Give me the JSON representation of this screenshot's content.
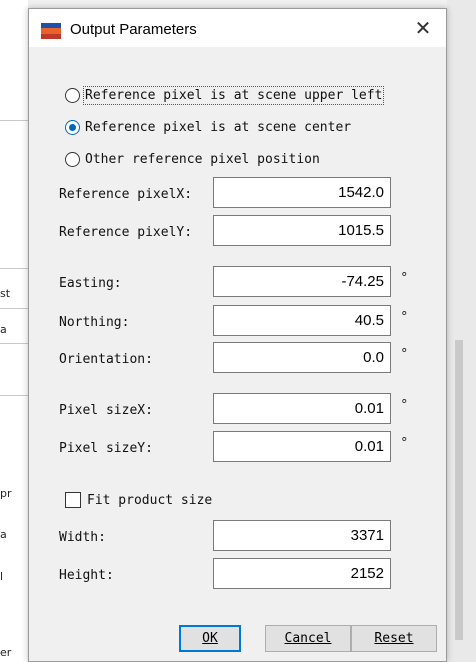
{
  "dialog": {
    "title": "Output Parameters",
    "close_symbol": "✕"
  },
  "background_fragments": [
    "st",
    "a",
    "pr",
    "a",
    "l",
    "er"
  ],
  "reference_options": [
    {
      "label": "Reference pixel is at scene upper left",
      "checked": false
    },
    {
      "label": "Reference pixel is at scene center",
      "checked": true
    },
    {
      "label": "Other reference pixel position",
      "checked": false
    }
  ],
  "fields": {
    "ref_pixel_x": {
      "label": "Reference pixelX:",
      "value": "1542.0",
      "unit": ""
    },
    "ref_pixel_y": {
      "label": "Reference pixelY:",
      "value": "1015.5",
      "unit": ""
    },
    "easting": {
      "label": "Easting:",
      "value": "-74.25",
      "unit": "°"
    },
    "northing": {
      "label": "Northing:",
      "value": "40.5",
      "unit": "°"
    },
    "orientation": {
      "label": "Orientation:",
      "value": "0.0",
      "unit": "°"
    },
    "pixel_size_x": {
      "label": "Pixel sizeX:",
      "value": "0.01",
      "unit": "°"
    },
    "pixel_size_y": {
      "label": "Pixel sizeY:",
      "value": "0.01",
      "unit": "°"
    },
    "width": {
      "label": "Width:",
      "value": "3371",
      "unit": ""
    },
    "height": {
      "label": "Height:",
      "value": "2152",
      "unit": ""
    }
  },
  "fit_product_size": {
    "label": "Fit product size",
    "checked": false
  },
  "buttons": {
    "ok": "OK",
    "cancel": "Cancel",
    "reset": "Reset"
  }
}
